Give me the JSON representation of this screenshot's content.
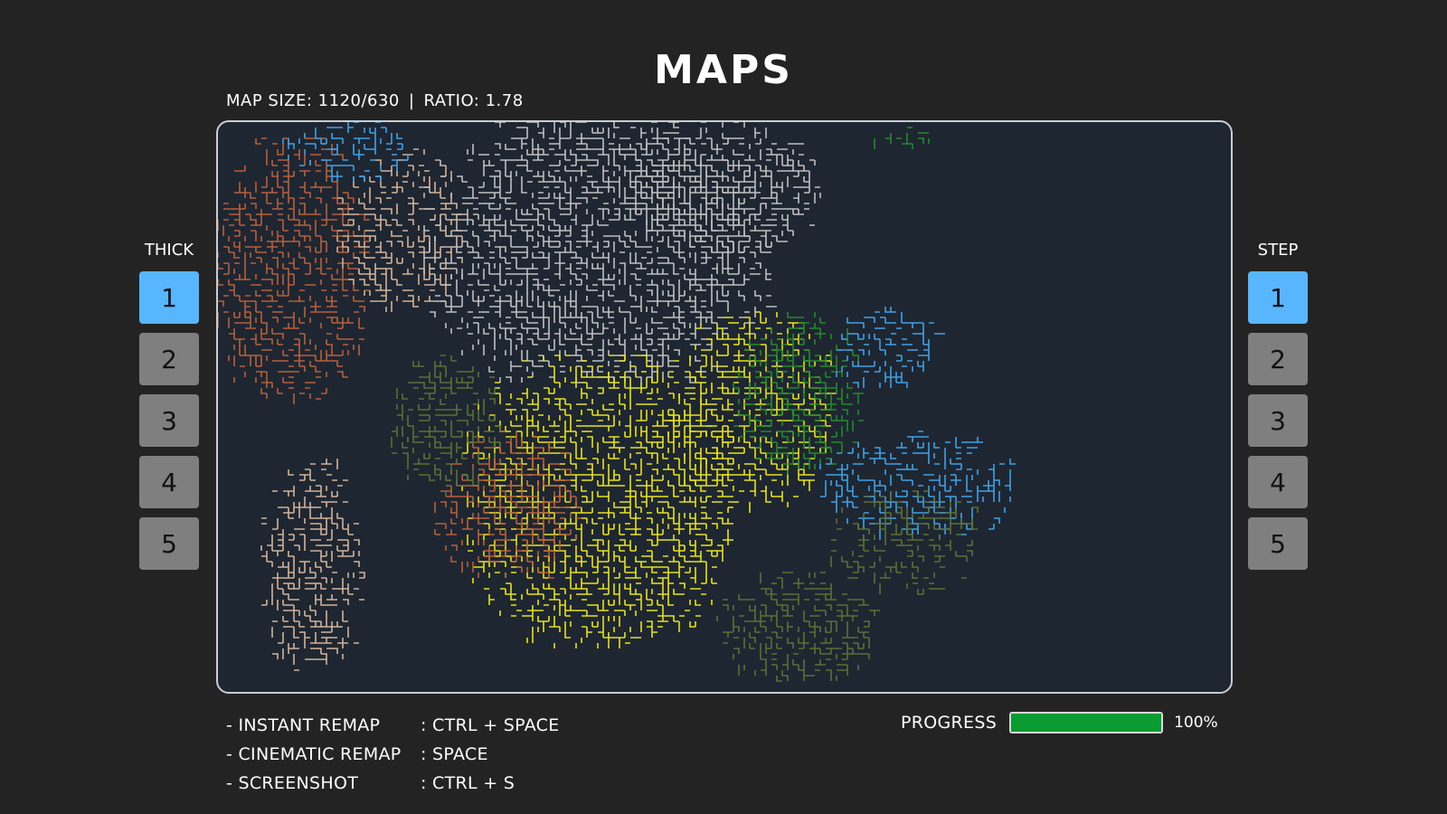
{
  "title": "MAPS",
  "info": {
    "map_size": "MAP SIZE: 1120/630",
    "separator": "|",
    "ratio": "RATIO: 1.78"
  },
  "thick": {
    "label": "THICK",
    "options": [
      "1",
      "2",
      "3",
      "4",
      "5"
    ],
    "selected": "1"
  },
  "step": {
    "label": "STEP",
    "options": [
      "1",
      "2",
      "3",
      "4",
      "5"
    ],
    "selected": "1"
  },
  "shortcuts": [
    {
      "action": "- INSTANT REMAP",
      "keys": ": CTRL + SPACE"
    },
    {
      "action": "- CINEMATIC REMAP",
      "keys": ": SPACE"
    },
    {
      "action": "- SCREENSHOT",
      "keys": ": CTRL + S"
    }
  ],
  "progress": {
    "label": "PROGRESS",
    "value": "100%",
    "fraction": 1.0
  },
  "map": {
    "background": "#1e2631",
    "region_colors": [
      "#b85f3a",
      "#d2b298",
      "#3ea1e8",
      "#bfbfbf",
      "#e6e21a",
      "#228a2c",
      "#5a7034"
    ]
  }
}
